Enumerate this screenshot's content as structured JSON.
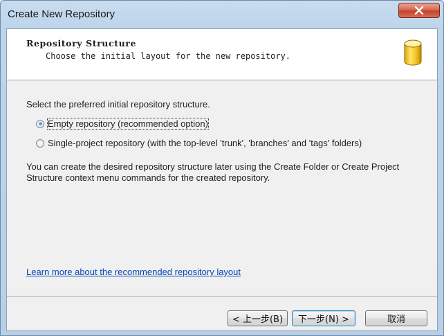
{
  "window": {
    "title": "Create New Repository",
    "close_glyph": "✕"
  },
  "header": {
    "title": "Repository Structure",
    "subtitle": "Choose the initial layout for the new repository.",
    "icon": "database-icon"
  },
  "body": {
    "intro": "Select the preferred initial repository structure.",
    "options": [
      {
        "label": "Empty repository (recommended option)",
        "checked": true
      },
      {
        "label": "Single-project repository (with the top-level 'trunk', 'branches' and 'tags' folders)",
        "checked": false
      }
    ],
    "note_line1": "You can create the desired repository structure later using the Create Folder or Create Project",
    "note_line2": "Structure context menu commands for the created repository.",
    "learn_more": "Learn more about the recommended repository layout"
  },
  "buttons": {
    "back": "< 上一步(B)",
    "next": "下一步(N) >",
    "cancel": "取消"
  },
  "colors": {
    "accent": "#3c7fb1",
    "link": "#0645b5",
    "close": "#c4432c"
  }
}
